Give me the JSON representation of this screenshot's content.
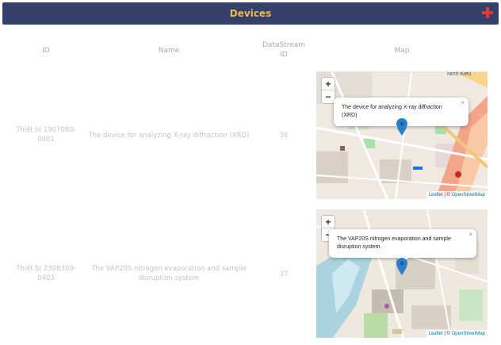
{
  "header": {
    "title": "Devices",
    "add_icon": "plus-icon",
    "accent_color": "#f2b94a",
    "bar_color": "#33406b",
    "add_color": "#e53935"
  },
  "table": {
    "columns": [
      "ID",
      "Name",
      "DataStream ID",
      "Map"
    ],
    "col_datastream_line1": "DataStream",
    "col_datastream_line2": "ID",
    "rows": [
      {
        "id_line1": "Thiết bị 1907080-",
        "id_line2": "0001",
        "name": "The device for analyzing X-ray diffraction (XRD)",
        "datastream_id": "36",
        "popup_text": "The device for analyzing X-ray diffraction (XRD)",
        "map_label": "Ninh Kiều"
      },
      {
        "id_line1": "Thiết bị 2308300-",
        "id_line2": "0403",
        "name_line1": "The VAP20S nitrogen evaporation and sample",
        "name_line2": "disruption system",
        "datastream_id": "37",
        "popup_line1": "The VAP20S nitrogen evaporation and sample",
        "popup_line2": "disruption system."
      }
    ]
  },
  "map": {
    "zoom_in": "+",
    "zoom_out": "−",
    "close": "×",
    "attribution_leaflet": "Leaflet",
    "attribution_sep": " | © ",
    "attribution_osm": "OpenStreetMap",
    "marker_color": "#2a81cb"
  }
}
